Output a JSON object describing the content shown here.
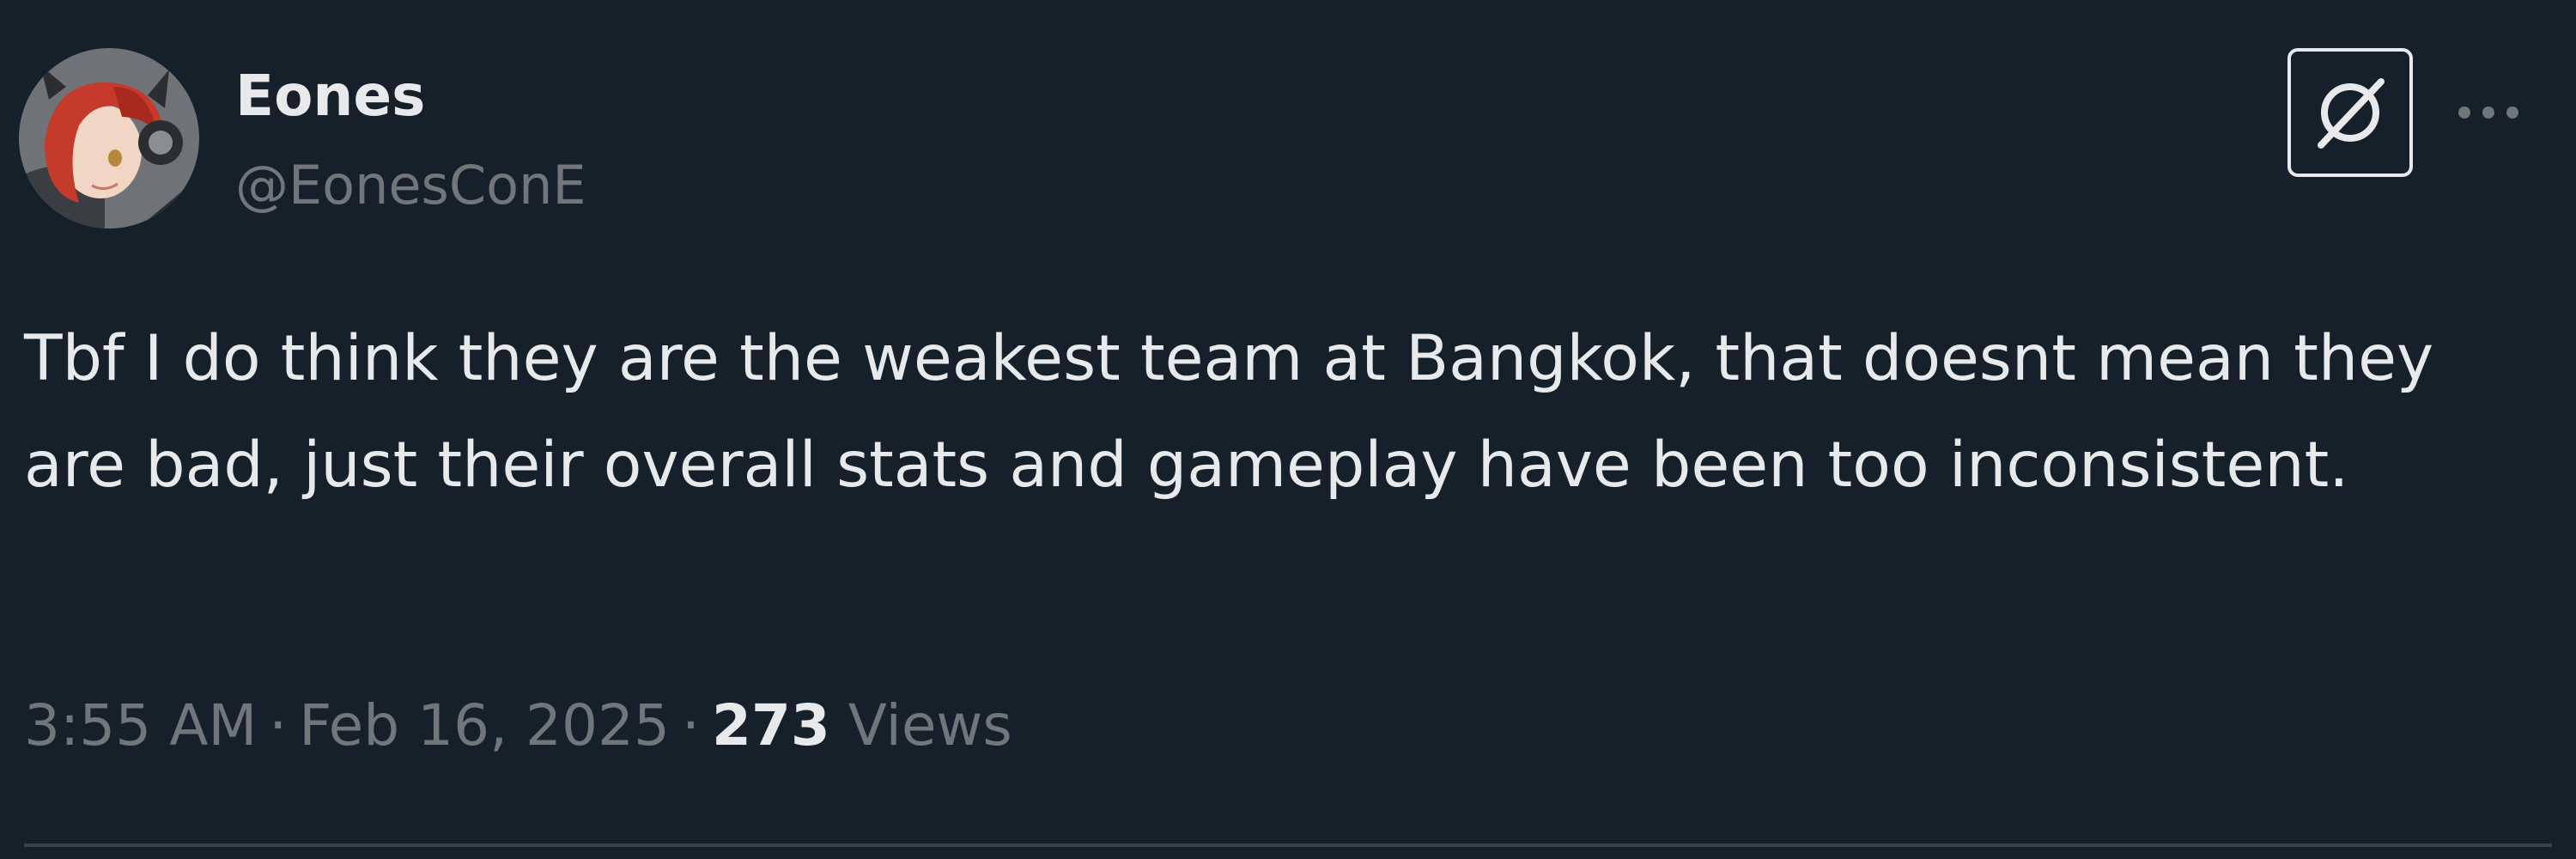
{
  "tweet": {
    "author": {
      "display_name": "Eones",
      "handle": "@EonesConE",
      "avatar_icon": "anime-avatar"
    },
    "text": "Tbf I do think they are the weakest team at Bangkok, that doesnt mean they are bad, just their overall stats and gameplay have been too inconsistent.",
    "time": "3:55 AM",
    "separator": "·",
    "date": "Feb 16, 2025",
    "views_count": "273",
    "views_label": "Views",
    "grok_icon": "grok-icon",
    "more_icon": "more-icon"
  },
  "colors": {
    "background": "#16202b",
    "text_primary": "#e7e9ea",
    "text_secondary": "#71767b",
    "divider": "#38444d"
  }
}
